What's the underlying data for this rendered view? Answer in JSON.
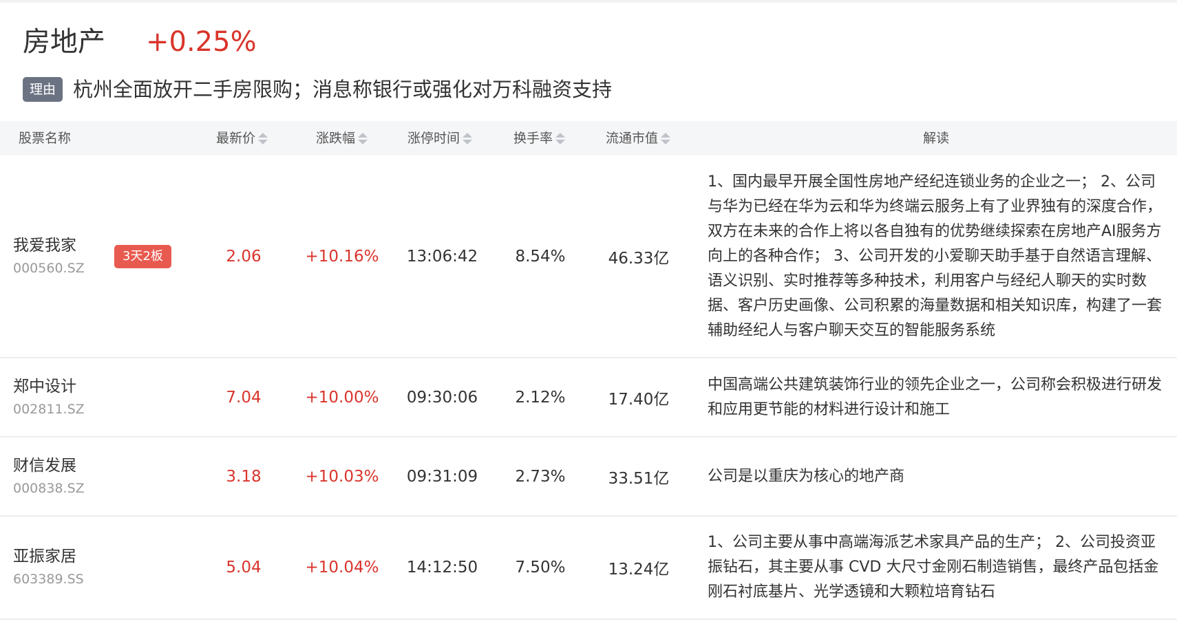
{
  "sector": {
    "name": "房地产",
    "change": "+0.25%",
    "reason_tag": "理由",
    "reason_text": "杭州全面放开二手房限购；消息称银行或强化对万科融资支持"
  },
  "table": {
    "headers": {
      "name": "股票名称",
      "price": "最新价",
      "change": "涨跌幅",
      "limit_time": "涨停时间",
      "turnover": "换手率",
      "market_cap": "流通市值",
      "analysis": "解读"
    },
    "rows": [
      {
        "name": "我爱我家",
        "code": "000560.SZ",
        "badge": "3天2板",
        "price": "2.06",
        "change": "+10.16%",
        "limit_time": "13:06:42",
        "turnover": "8.54%",
        "market_cap": "46.33亿",
        "analysis": "1、国内最早开展全国性房地产经纪连锁业务的企业之一； 2、公司与华为已经在华为云和华为终端云服务上有了业界独有的深度合作，双方在未来的合作上将以各自独有的优势继续探索在房地产AI服务方向上的各种合作； 3、公司开发的小爱聊天助手基于自然语言理解、语义识别、实时推荐等多种技术，利用客户与经纪人聊天的实时数据、客户历史画像、公司积累的海量数据和相关知识库，构建了一套辅助经纪人与客户聊天交互的智能服务系统"
      },
      {
        "name": "郑中设计",
        "code": "002811.SZ",
        "badge": "",
        "price": "7.04",
        "change": "+10.00%",
        "limit_time": "09:30:06",
        "turnover": "2.12%",
        "market_cap": "17.40亿",
        "analysis": "中国高端公共建筑装饰行业的领先企业之一，公司称会积极进行研发和应用更节能的材料进行设计和施工"
      },
      {
        "name": "财信发展",
        "code": "000838.SZ",
        "badge": "",
        "price": "3.18",
        "change": "+10.03%",
        "limit_time": "09:31:09",
        "turnover": "2.73%",
        "market_cap": "33.51亿",
        "analysis": "公司是以重庆为核心的地产商"
      },
      {
        "name": "亚振家居",
        "code": "603389.SS",
        "badge": "",
        "price": "5.04",
        "change": "+10.04%",
        "limit_time": "14:12:50",
        "turnover": "7.50%",
        "market_cap": "13.24亿",
        "analysis": "1、公司主要从事中高端海派艺术家具产品的生产； 2、公司投资亚振钻石，其主要从事 CVD 大尺寸金刚石制造销售，最终产品包括金刚石衬底基片、光学透镜和大颗粒培育钻石"
      }
    ]
  }
}
